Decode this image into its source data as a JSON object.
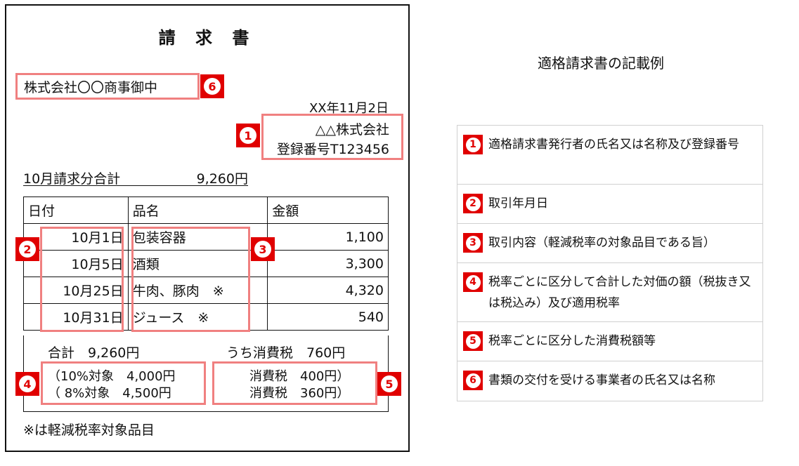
{
  "invoice": {
    "title": "請 求 書",
    "recipient": "株式会社〇〇商事御中",
    "date": "XX年11月2日",
    "issuer_name": "△△株式会社",
    "registration": "登録番号T123456",
    "summary_label": "10月請求分合計",
    "summary_amount": "9,260円",
    "headers": [
      "日付",
      "品名",
      "金額"
    ],
    "rows": [
      {
        "date": "10月1日",
        "item": "包装容器",
        "amount": "1,100"
      },
      {
        "date": "10月5日",
        "item": "酒類",
        "amount": "3,300"
      },
      {
        "date": "10月25日",
        "item": "牛肉、豚肉　※",
        "amount": "4,320"
      },
      {
        "date": "10月31日",
        "item": "ジュース　※",
        "amount": "540"
      }
    ],
    "total_label": "合計　9,260円",
    "tax_total": "うち消費税　760円",
    "rate10": "（10%対象　4,000円",
    "rate8": "（ 8%対象　4,500円",
    "tax10": "消費税　400円）",
    "tax8": "消費税　360円）",
    "note": "※は軽減税率対象品目"
  },
  "badges": [
    "1",
    "2",
    "3",
    "4",
    "5",
    "6"
  ],
  "badge_color": "#e00000",
  "highlight_color": "#f08080",
  "legend": {
    "title": "適格請求書の記載例",
    "items": [
      {
        "num": "1",
        "text": "適格請求書発行者の氏名又は名称及び登録番号"
      },
      {
        "num": "2",
        "text": "取引年月日"
      },
      {
        "num": "3",
        "text": "取引内容（軽減税率の対象品目である旨）"
      },
      {
        "num": "4",
        "text": "税率ごとに区分して合計した対価の額（税抜き又は税込み）及び適用税率"
      },
      {
        "num": "5",
        "text": "税率ごとに区分した消費税額等"
      },
      {
        "num": "6",
        "text": "書類の交付を受ける事業者の氏名又は名称"
      }
    ]
  }
}
